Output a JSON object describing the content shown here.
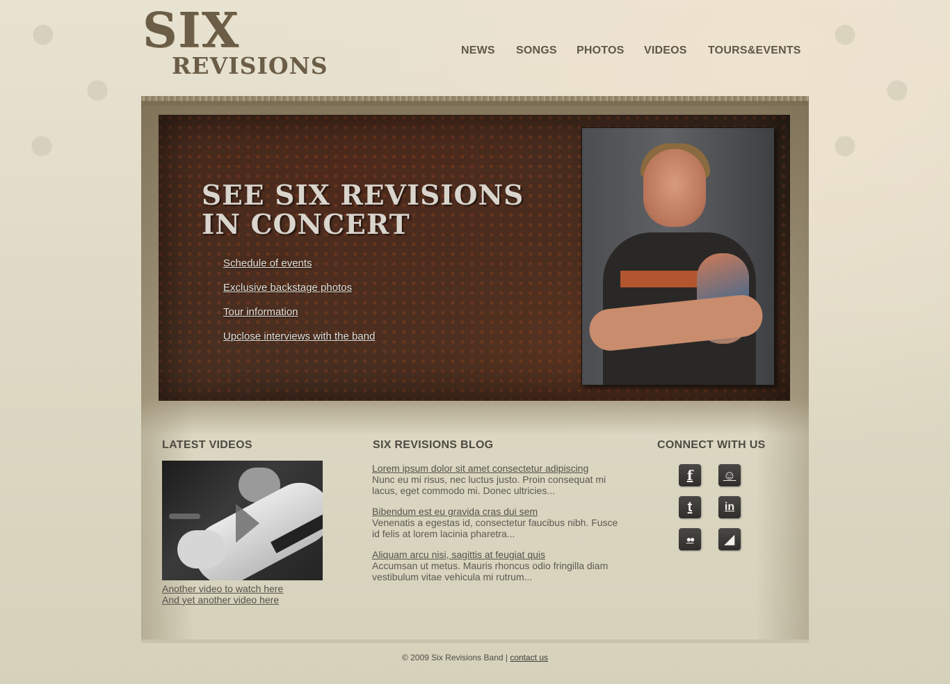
{
  "logo": {
    "line1": "SIX",
    "line2": "REVISIONS"
  },
  "nav": [
    {
      "label": "NEWS"
    },
    {
      "label": "SONGS"
    },
    {
      "label": "PHOTOS"
    },
    {
      "label": "VIDEOS"
    },
    {
      "label": "TOURS&EVENTS"
    }
  ],
  "hero": {
    "title_line1": "SEE SIX REVISIONS",
    "title_line2": "IN CONCERT",
    "links": [
      "Schedule of events",
      "Exclusive backstage photos",
      "Tour information",
      "Upclose interviews with the band"
    ]
  },
  "videos": {
    "heading": "LATEST VIDEOS",
    "links": [
      "Another video to watch here",
      "And yet another video here"
    ]
  },
  "blog": {
    "heading": "SIX REVISIONS BLOG",
    "posts": [
      {
        "title": "Lorem ipsum dolor sit amet consectetur adipiscing",
        "excerpt": "Nunc eu mi risus, nec luctus justo. Proin consequat mi lacus, eget commodo mi. Donec ultricies..."
      },
      {
        "title": "Bibendum est eu gravida cras dui sem",
        "excerpt": "Venenatis a egestas id, consectetur faucibus nibh. Fusce id felis at lorem lacinia pharetra..."
      },
      {
        "title": "Aliquam arcu nisi, sagittis at feugiat quis",
        "excerpt": "Accumsan ut metus. Mauris rhoncus odio fringilla diam vestibulum vitae vehicula mi rutrum..."
      }
    ]
  },
  "connect": {
    "heading": "CONNECT WITH US",
    "icons": [
      {
        "name": "facebook-icon",
        "glyph": "f"
      },
      {
        "name": "myspace-icon",
        "glyph": "☺"
      },
      {
        "name": "twitter-icon",
        "glyph": "t"
      },
      {
        "name": "linkedin-icon",
        "glyph": "in"
      },
      {
        "name": "flickr-icon",
        "glyph": "●●"
      },
      {
        "name": "rss-icon",
        "glyph": "◢"
      }
    ]
  },
  "footer": {
    "text": "© 2009 Six Revisions Band | ",
    "contact": "contact us"
  },
  "colors": {
    "accent": "#6b5d46",
    "text": "#55524a",
    "hero_bg": "#3b2a20"
  }
}
